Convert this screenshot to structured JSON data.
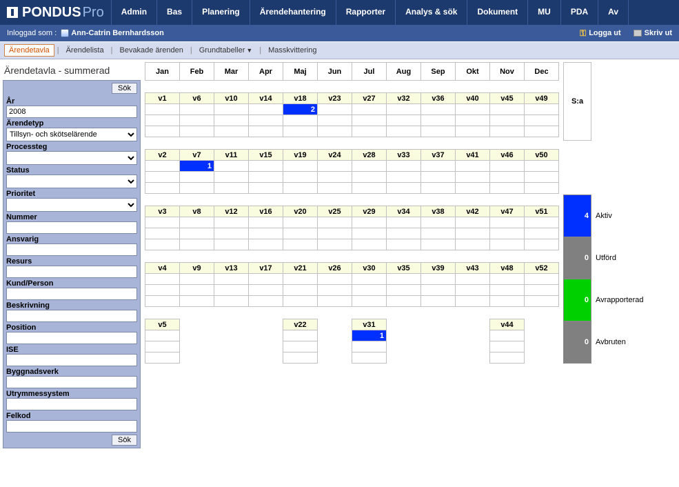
{
  "brand": {
    "name": "PONDUS",
    "suffix": "Pro"
  },
  "mainmenu": [
    "Admin",
    "Bas",
    "Planering",
    "Ärendehantering",
    "Rapporter",
    "Analys & sök",
    "Dokument",
    "MU",
    "PDA",
    "Av"
  ],
  "userbar": {
    "loggedInLabel": "Inloggad som :",
    "userName": "Ann-Catrin Bernhardsson",
    "logout": "Logga ut",
    "print": "Skriv ut"
  },
  "subtabs": {
    "items": [
      "Ärendetavla",
      "Ärendelista",
      "Bevakade ärenden",
      "Grundtabeller",
      "Masskvittering"
    ],
    "activeIndex": 0,
    "dropdownIndex": 3
  },
  "pageTitle": "Ärendetavla - summerad",
  "filters": {
    "searchLabel": "Sök",
    "fields": [
      {
        "label": "År",
        "type": "text",
        "value": "2008"
      },
      {
        "label": "Ärendetyp",
        "type": "select",
        "value": "Tillsyn- och skötselärende"
      },
      {
        "label": "Processteg",
        "type": "select",
        "value": ""
      },
      {
        "label": "Status",
        "type": "select",
        "value": ""
      },
      {
        "label": "Prioritet",
        "type": "select",
        "value": ""
      },
      {
        "label": "Nummer",
        "type": "text",
        "value": ""
      },
      {
        "label": "Ansvarig",
        "type": "text",
        "value": ""
      },
      {
        "label": "Resurs",
        "type": "text",
        "value": ""
      },
      {
        "label": "Kund/Person",
        "type": "text",
        "value": ""
      },
      {
        "label": "Beskrivning",
        "type": "text",
        "value": ""
      },
      {
        "label": "Position",
        "type": "text",
        "value": ""
      },
      {
        "label": "ISE",
        "type": "text",
        "value": ""
      },
      {
        "label": "Byggnadsverk",
        "type": "text",
        "value": ""
      },
      {
        "label": "Utrymmessystem",
        "type": "text",
        "value": ""
      },
      {
        "label": "Felkod",
        "type": "text",
        "value": ""
      }
    ]
  },
  "months": [
    "Jan",
    "Feb",
    "Mar",
    "Apr",
    "Maj",
    "Jun",
    "Jul",
    "Aug",
    "Sep",
    "Okt",
    "Nov",
    "Dec"
  ],
  "weekRows": [
    [
      "v1",
      "v6",
      "v10",
      "v14",
      "v18",
      "v23",
      "v27",
      "v32",
      "v36",
      "v40",
      "v45",
      "v49"
    ],
    [
      "v2",
      "v7",
      "v11",
      "v15",
      "v19",
      "v24",
      "v28",
      "v33",
      "v37",
      "v41",
      "v46",
      "v50"
    ],
    [
      "v3",
      "v8",
      "v12",
      "v16",
      "v20",
      "v25",
      "v29",
      "v34",
      "v38",
      "v42",
      "v47",
      "v51"
    ],
    [
      "v4",
      "v9",
      "v13",
      "v17",
      "v21",
      "v26",
      "v30",
      "v35",
      "v39",
      "v43",
      "v48",
      "v52"
    ],
    [
      "v5",
      "",
      "",
      "",
      "v22",
      "",
      "v31",
      "",
      "",
      "",
      "v44",
      ""
    ]
  ],
  "cellData": {
    "0-4-0": "2",
    "1-1-0": "1",
    "4-6-0": "1"
  },
  "sumHeader": "S:a",
  "legend": [
    {
      "color": "#0030ff",
      "count": "4",
      "label": "Aktiv"
    },
    {
      "color": "#808080",
      "count": "0",
      "label": "Utförd"
    },
    {
      "color": "#00d000",
      "count": "0",
      "label": "Avrapporterad"
    },
    {
      "color": "#808080",
      "count": "0",
      "label": "Avbruten"
    }
  ]
}
